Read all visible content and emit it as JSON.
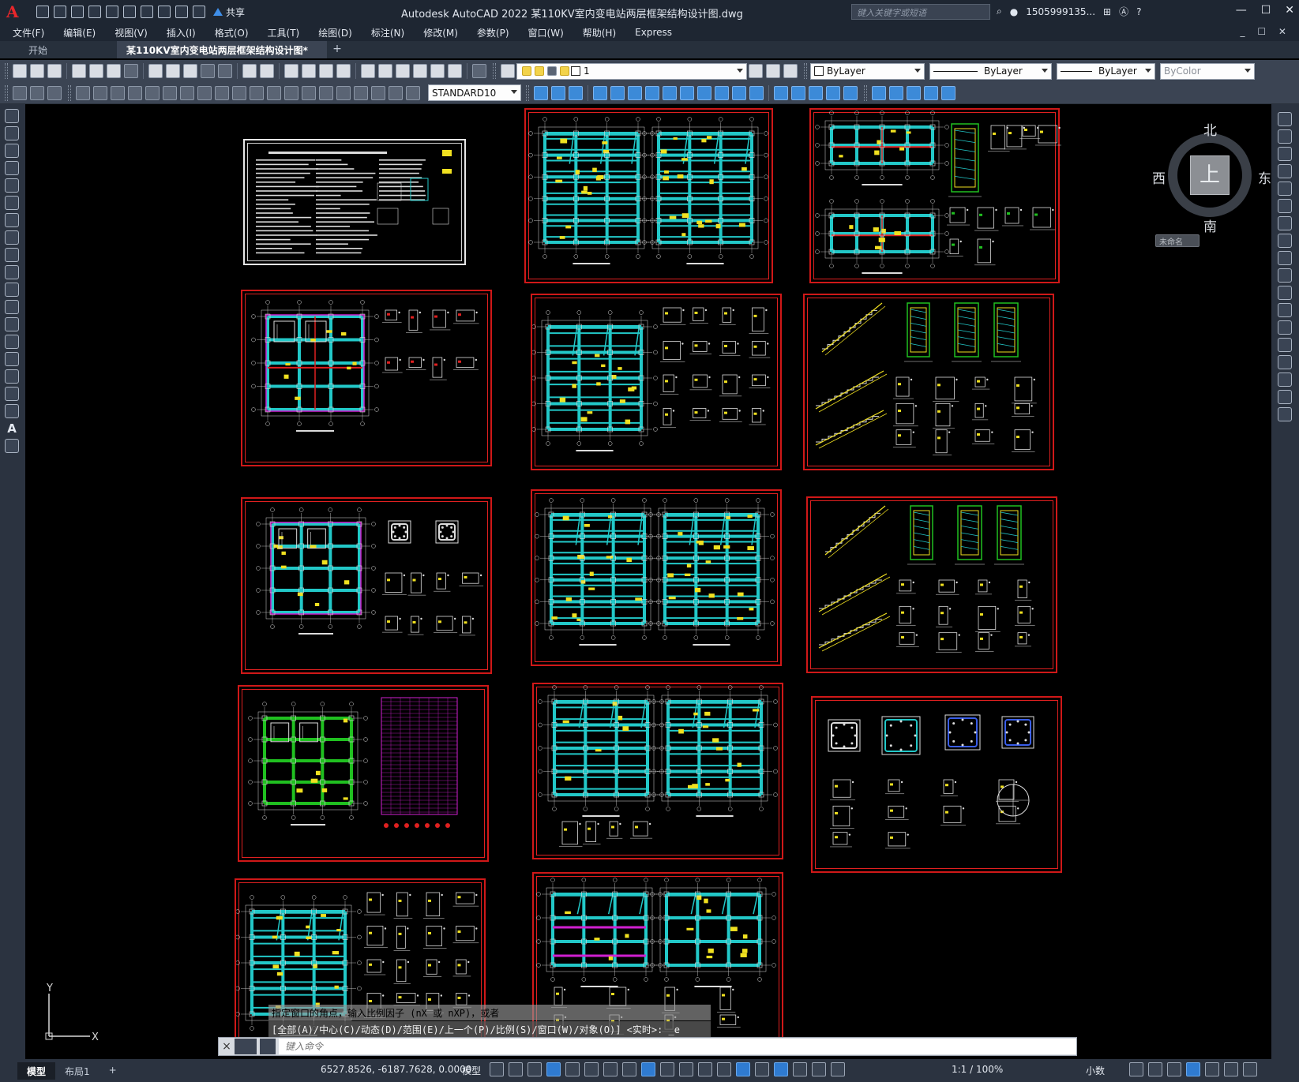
{
  "app": {
    "title": "Autodesk AutoCAD 2022    某110KV室内变电站两层框架结构设计图.dwg",
    "logo": "A",
    "share_label": "共享",
    "search_placeholder": "键入关键字或短语",
    "user": "1505999135...",
    "help": "?"
  },
  "menu": [
    "文件(F)",
    "编辑(E)",
    "视图(V)",
    "插入(I)",
    "格式(O)",
    "工具(T)",
    "绘图(D)",
    "标注(N)",
    "修改(M)",
    "参数(P)",
    "窗口(W)",
    "帮助(H)",
    "Express"
  ],
  "tabs": {
    "start": "开始",
    "active": "某110KV室内变电站两层框架结构设计图*",
    "add": "+"
  },
  "toolbar": {
    "layer_value": "1",
    "color_value": "ByLayer",
    "linetype_value": "ByLayer",
    "lineweight_value": "ByLayer",
    "plotstyle_value": "ByColor",
    "textstyle_value": "STANDARD10"
  },
  "leftbar": {
    "text_tool": "A"
  },
  "viewcube": {
    "north": "北",
    "south": "南",
    "west": "西",
    "east": "东",
    "face": "上",
    "wcs": "未命名"
  },
  "ucs": {
    "y": "Y",
    "x": "X"
  },
  "command": {
    "history_1": "指定窗口的角点，输入比例因子 (nX 或 nXP)，或者",
    "history_2": "[全部(A)/中心(C)/动态(D)/范围(E)/上一个(P)/比例(S)/窗口(W)/对象(O)] <实时>: _e",
    "placeholder": "键入命令",
    "close": "×"
  },
  "status": {
    "model_tab": "模型",
    "layout_tab": "布局1",
    "add": "+",
    "coordinates": "6527.8526, -6187.7628, 0.0000",
    "space": "模型",
    "scale": "1:1 / 100%",
    "units": "小数"
  },
  "colors": {
    "frame_red": "#d01818",
    "beam_cyan": "#22c8c8",
    "annot_yellow": "#f0e020",
    "green": "#20c020",
    "magenta": "#d020d0",
    "dim_white": "#dcdcdc"
  }
}
